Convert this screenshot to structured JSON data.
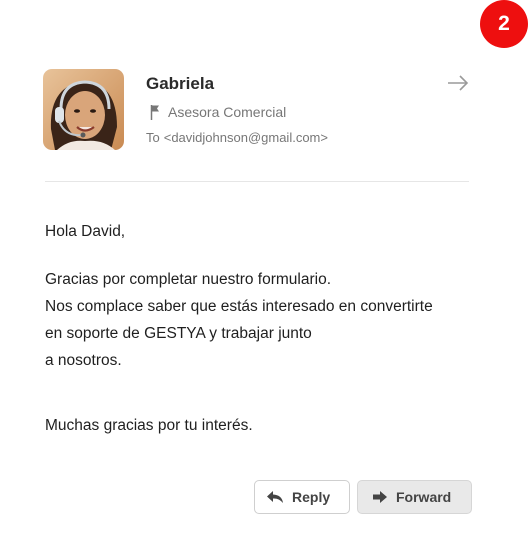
{
  "step_badge": "2",
  "sender": {
    "name": "Gabriela",
    "role": "Asesora Comercial",
    "to_label": "To",
    "to_address": "<davidjohnson@gmail.com>"
  },
  "body": {
    "greeting": "Hola David,",
    "line1": "Gracias por completar nuestro formulario.",
    "line2": "Nos complace saber que estás interesado en convertirte",
    "line3": "en soporte de GESTYA y trabajar junto",
    "line4": "a nosotros.",
    "closing": "Muchas gracias por tu interés."
  },
  "actions": {
    "reply_label": "Reply",
    "forward_label": "Forward"
  },
  "icons": {
    "header_action": "arrow-right-icon",
    "role": "flag-icon",
    "reply": "reply-arrow-icon",
    "forward": "forward-arrow-icon"
  },
  "colors": {
    "badge": "#ee0f0f",
    "muted_text": "#777777",
    "forward_button_bg": "#e9e9e9"
  }
}
